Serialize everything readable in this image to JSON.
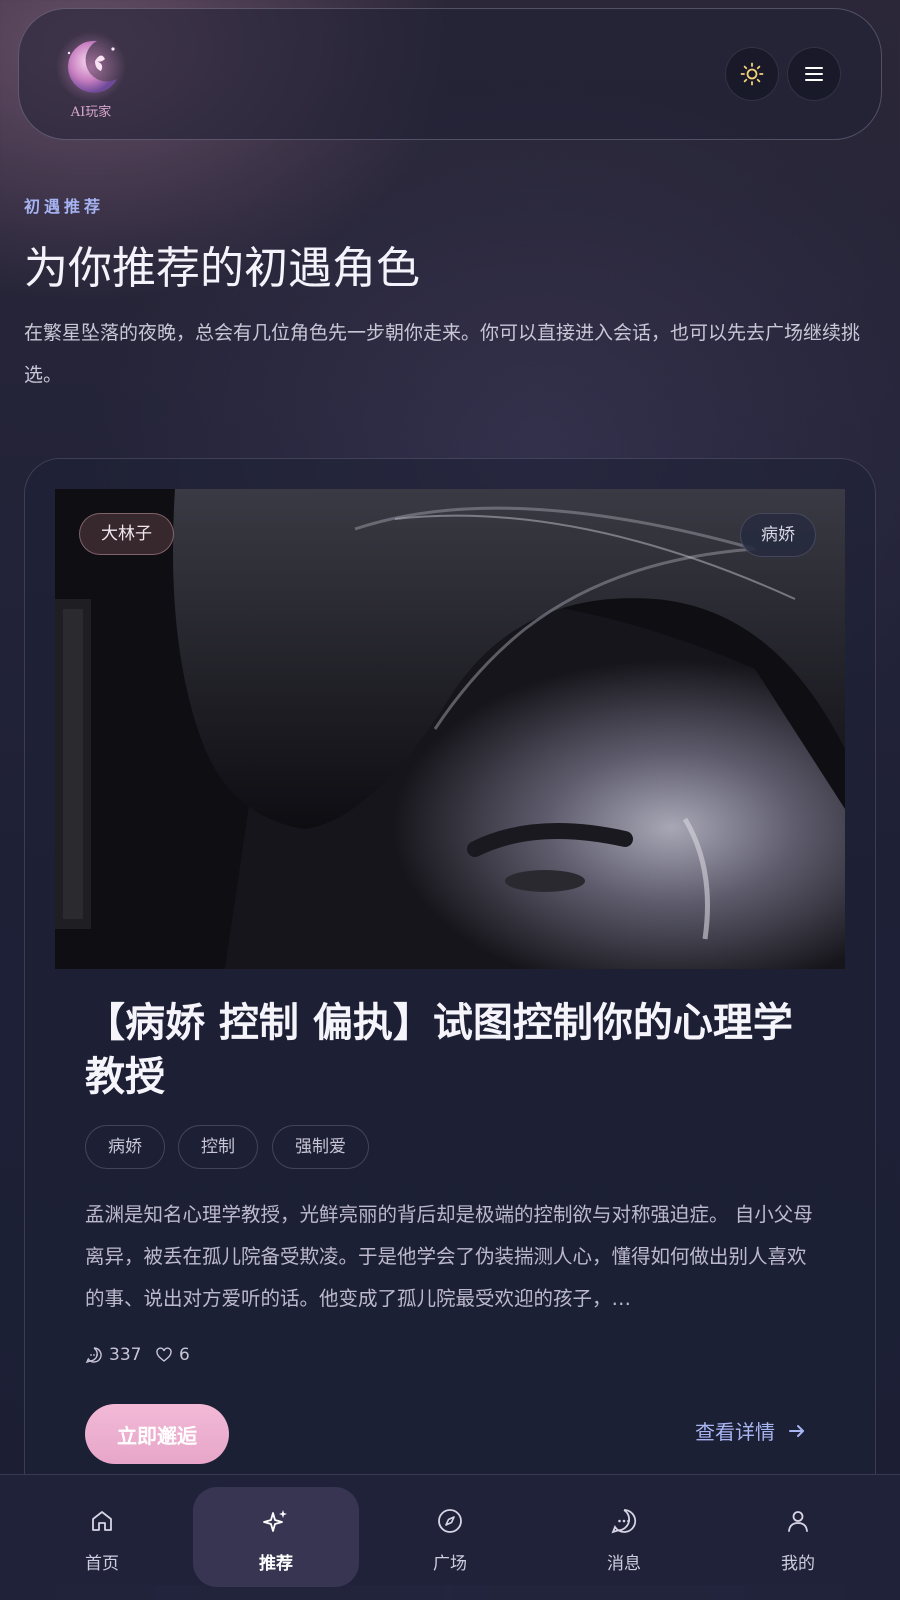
{
  "header": {
    "logo_text": "AI玩家",
    "theme_icon": "sun-icon",
    "menu_icon": "menu-icon"
  },
  "intro": {
    "eyebrow": "初遇推荐",
    "title": "为你推荐的初遇角色",
    "lead": "在繁星坠落的夜晚，总会有几位角色先一步朝你走来。你可以直接进入会话，也可以先去广场继续挑选。"
  },
  "card": {
    "author": "大林子",
    "category": "病娇",
    "title": "【病娇 控制 偏执】试图控制你的心理学教授",
    "tags": [
      "病娇",
      "控制",
      "强制爱"
    ],
    "description": "孟渊是知名心理学教授，光鲜亮丽的背后却是极端的控制欲与对称强迫症。 自小父母离异，被丢在孤儿院备受欺凌。于是他学会了伪装揣测人心，懂得如何做出别人喜欢的事、说出对方爱听的话。他变成了孤儿院最受欢迎的孩子，…",
    "chats": "337",
    "likes": "6",
    "cta_label": "立即邂逅",
    "detail_label": "查看详情"
  },
  "tabs": [
    {
      "label": "首页",
      "icon": "home-icon"
    },
    {
      "label": "推荐",
      "icon": "sparkle-icon"
    },
    {
      "label": "广场",
      "icon": "compass-icon"
    },
    {
      "label": "消息",
      "icon": "chat-bubble-icon"
    },
    {
      "label": "我的",
      "icon": "user-icon"
    }
  ],
  "colors": {
    "accent": "#a7b5f3",
    "cta": "#f2b9d6",
    "background": "#1f2136"
  }
}
